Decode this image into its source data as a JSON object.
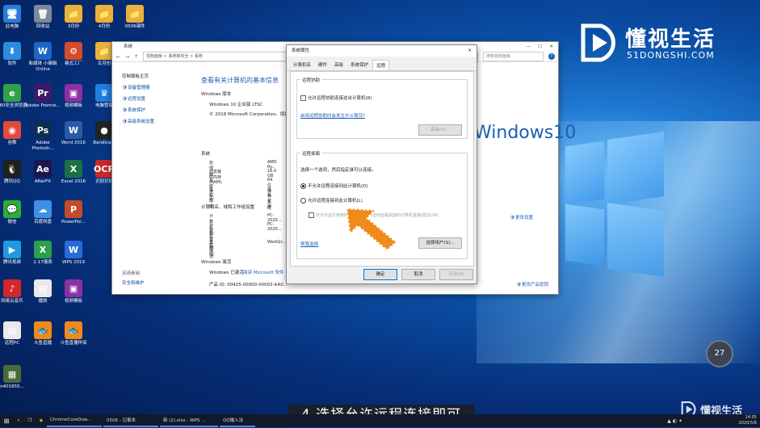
{
  "desktop_icons": [
    {
      "label": "此电脑",
      "color": "#2a7bd8",
      "glyph": "🖥"
    },
    {
      "label": "回收站",
      "color": "#7a8a9a",
      "glyph": "🗑"
    },
    {
      "label": "3月份",
      "color": "#e9b23a",
      "glyph": "📁"
    },
    {
      "label": "4月份",
      "color": "#e9b23a",
      "glyph": "📁"
    },
    {
      "label": "0506课件",
      "color": "#e9b23a",
      "glyph": "📁"
    },
    {
      "label": "软件",
      "color": "#2d8be0",
      "glyph": "⬇"
    },
    {
      "label": "新媒体 小编辑 Online",
      "color": "#1b65c6",
      "glyph": "W"
    },
    {
      "label": "格式工厂",
      "color": "#d84a2a",
      "glyph": "⚙"
    },
    {
      "label": "五月份",
      "color": "#e9b23a",
      "glyph": "📁"
    },
    {
      "label": "360安全浏览器",
      "color": "#31a14a",
      "glyph": "e"
    },
    {
      "label": "Adobe Premie...",
      "color": "#3b1b66",
      "glyph": "Pr"
    },
    {
      "label": "视频模板",
      "color": "#8d2fa5",
      "glyph": "▣"
    },
    {
      "label": "电脑管家",
      "color": "#1f7ee0",
      "glyph": "♛"
    },
    {
      "label": "谷歌",
      "color": "#e24b3b",
      "glyph": "◉"
    },
    {
      "label": "Adobe Photosh...",
      "color": "#0e2d53",
      "glyph": "Ps"
    },
    {
      "label": "Word 2016",
      "color": "#2b5ba7",
      "glyph": "W"
    },
    {
      "label": "Bandicam",
      "color": "#222222",
      "glyph": "●"
    },
    {
      "label": "腾讯QQ",
      "color": "#1f1f1f",
      "glyph": "🐧"
    },
    {
      "label": "AfterFX",
      "color": "#1d1550",
      "glyph": "Ae"
    },
    {
      "label": "Excel 2016",
      "color": "#1d7044",
      "glyph": "X"
    },
    {
      "label": "识别识别",
      "color": "#c8282a",
      "glyph": "OCR"
    },
    {
      "label": "微信",
      "color": "#2aae3c",
      "glyph": "💬"
    },
    {
      "label": "百度网盘",
      "color": "#3f8fe6",
      "glyph": "☁"
    },
    {
      "label": "PowerPoi...",
      "color": "#c54a2a",
      "glyph": "P"
    },
    {
      "label": "腾讯视频",
      "color": "#1f9ae0",
      "glyph": "▶"
    },
    {
      "label": "1-17报表",
      "color": "#2aa04a",
      "glyph": "X"
    },
    {
      "label": "WPS 2019",
      "color": "#2969d8",
      "glyph": "W"
    },
    {
      "label": "网易云音乐",
      "color": "#d0282a",
      "glyph": "♪"
    },
    {
      "label": "播放",
      "color": "#e9e9e9",
      "glyph": "▤"
    },
    {
      "label": "视频模板",
      "color": "#8d2fa5",
      "glyph": "▣"
    },
    {
      "label": "远程PC",
      "color": "#e9e9e9",
      "glyph": "▤"
    },
    {
      "label": "斗鱼直播",
      "color": "#f08a1a",
      "glyph": "🐟"
    },
    {
      "label": "斗鱼直播伴侣",
      "color": "#f08a1a",
      "glyph": "🐟"
    },
    {
      "label": "n401855...",
      "color": "#4a6a3a",
      "glyph": "▦"
    }
  ],
  "control_panel": {
    "title": "系统",
    "breadcrumb": "控制面板 > 系统和安全 > 系统",
    "search_placeholder": "搜索控制面板",
    "side_items": [
      "控制面板主页",
      "设备管理器",
      "远程设置",
      "系统保护",
      "高级系统设置"
    ],
    "see_also_title": "另请参阅",
    "see_also_item": "安全和维护",
    "heading": "查看有关计算机的基本信息",
    "win_edition_title": "Windows 版本",
    "edition": "Windows 10 企业版 LTSC",
    "copyright": "© 2018 Microsoft Corporation。保留所有权利。",
    "system_title": "系统",
    "rows": [
      {
        "k": "处理器:",
        "v": "AMD Ry..."
      },
      {
        "k": "已安装的内存(RAM):",
        "v": "16.0 GB"
      },
      {
        "k": "系统类型:",
        "v": "64 位操作系统"
      },
      {
        "k": "笔和触控:",
        "v": "没有可用"
      }
    ],
    "network_title": "计算机名、域和工作组设置",
    "rows2": [
      {
        "k": "计算机名:",
        "v": "PC-2020..."
      },
      {
        "k": "计算机全名:",
        "v": "PC-2020..."
      },
      {
        "k": "计算机描述:",
        "v": ""
      },
      {
        "k": "工作组:",
        "v": "WorkGr..."
      }
    ],
    "activation_title": "Windows 激活",
    "activation_status": "Windows 已激活",
    "activation_link": "阅读 Microsoft 软件许可条款",
    "product_id": "产品 ID: 00425-00000-00002-AA0...",
    "change_settings": "更改设置",
    "change_key": "更改产品密钥",
    "win10_logo": "Windows10"
  },
  "dialog": {
    "title": "系统属性",
    "tabs": [
      "计算机名",
      "硬件",
      "高级",
      "系统保护",
      "远程"
    ],
    "assist_title": "远程协助",
    "assist_checkbox": "允许远程协助连接这台计算机(R)",
    "assist_link": "启用远程协助时会发生什么情况?",
    "advanced_button": "高级(V)...",
    "desktop_title": "远程桌面",
    "desktop_desc": "选择一个选项，然后指定谁可以连接。",
    "radio_no": "不允许远程连接到此计算机(D)",
    "radio_yes": "允许远程连接到此计算机(L)",
    "nla_checkbox": "仅允许运行使用网络级别身份验证的远程桌面的计算机连接(建议)(N)",
    "help_link": "帮我选择",
    "select_users": "选择用户(S)...",
    "ok": "确定",
    "cancel": "取消",
    "apply": "应用(A)"
  },
  "taskbar": {
    "items": [
      "ChromeCoreDow...",
      "0506 - 记事本",
      "新 (2).xlsx - WPS ...",
      "QQ输入法"
    ],
    "time": "14:05",
    "date": "2020/5/6"
  },
  "speed_badge": "27",
  "logo": {
    "name": "懂视生活",
    "domain": "51DONGSHI.COM",
    "watermark": "懂视生活"
  },
  "caption": "4.选择允许远程连接即可"
}
